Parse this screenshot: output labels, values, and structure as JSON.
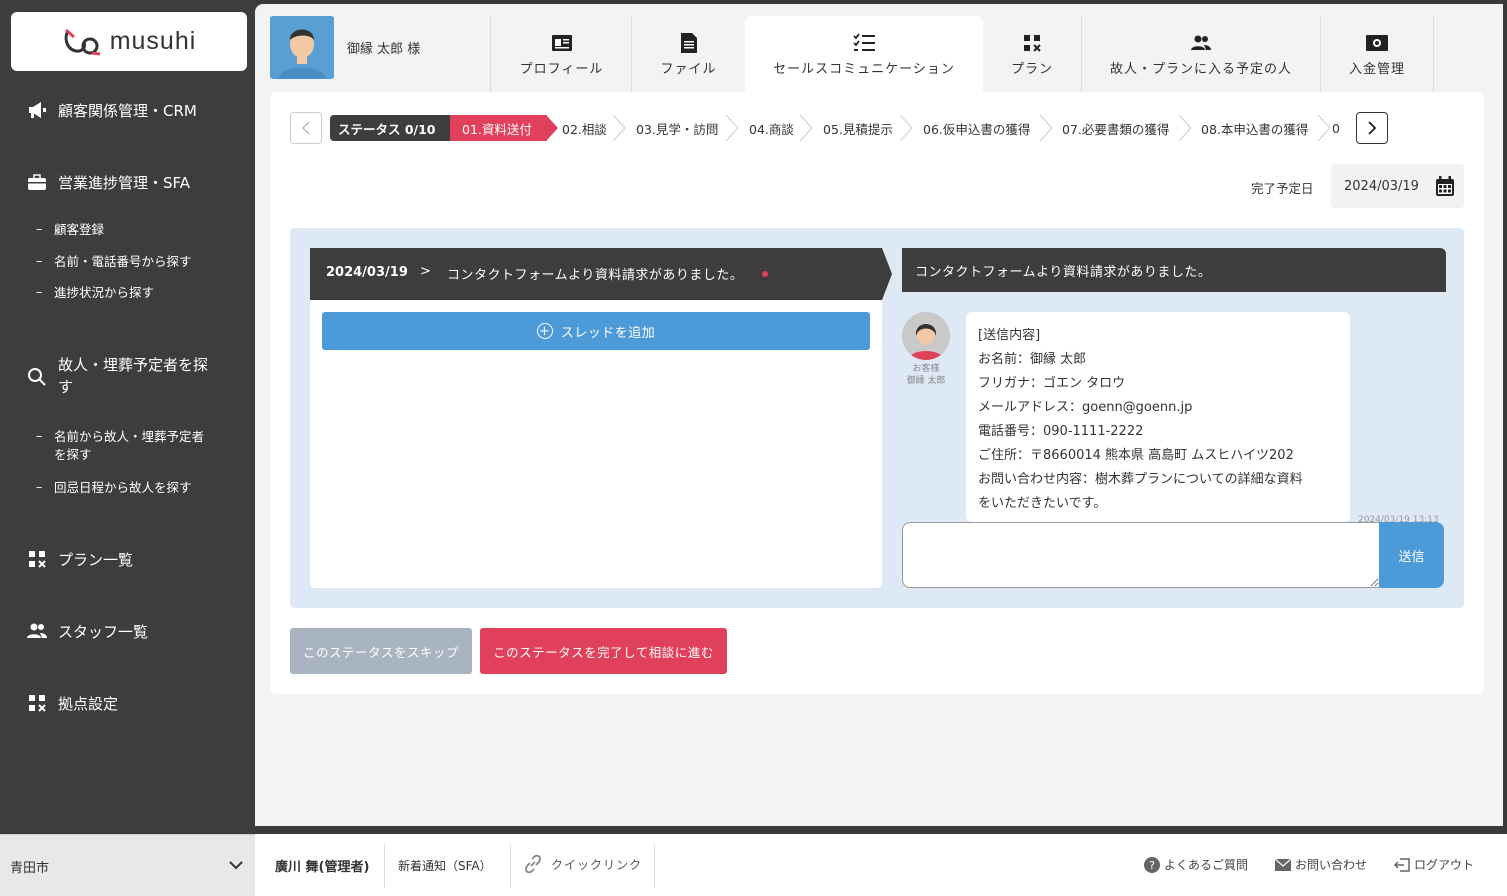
{
  "brand": {
    "name": "musuhi"
  },
  "sidebar": {
    "sections": [
      {
        "label": "顧客関係管理・CRM",
        "icon": "megaphone-icon"
      },
      {
        "label": "営業進捗管理・SFA",
        "icon": "briefcase-icon"
      }
    ],
    "sfa_items": [
      "顧客登録",
      "名前・電話番号から探す",
      "進捗状況から探す"
    ],
    "search_section": {
      "label_line1": "故人・埋葬予定者を探",
      "label_line2": "す",
      "icon": "search-icon"
    },
    "search_items": [
      {
        "line1": "名前から故人・埋葬予定者",
        "line2": "を探す"
      },
      {
        "line1": "回忌日程から故人を探す",
        "line2": ""
      }
    ],
    "bottom_sections": [
      {
        "label": "プラン一覧",
        "icon": "plan-icon"
      },
      {
        "label": "スタッフ一覧",
        "icon": "people-icon"
      },
      {
        "label": "拠点設定",
        "icon": "plan-icon"
      }
    ]
  },
  "customer": {
    "name": "御縁 太郎 様"
  },
  "tabs": [
    {
      "label": "プロフィール",
      "icon": "profile-card-icon"
    },
    {
      "label": "ファイル",
      "icon": "file-icon"
    },
    {
      "label": "セールスコミュニケーション",
      "icon": "checklist-icon"
    },
    {
      "label": "プラン",
      "icon": "plan-icon"
    },
    {
      "label": "故人・プランに入る予定の人",
      "icon": "people-icon"
    },
    {
      "label": "入金管理",
      "icon": "money-icon"
    }
  ],
  "status": {
    "label": "ステータス 0/10",
    "steps": [
      "01.資料送付",
      "02.相談",
      "03.見学・訪問",
      "04.商談",
      "05.見積提示",
      "06.仮申込書の獲得",
      "07.必要書類の獲得",
      "08.本申込書の獲得",
      "0"
    ],
    "active_index": 0
  },
  "due": {
    "label": "完了予定日",
    "value": "2024/03/19"
  },
  "thread": {
    "date": "2024/03/19",
    "separator": ">",
    "title": "コンタクトフォームより資料請求がありました。",
    "add_button": "スレッドを追加"
  },
  "conversation": {
    "title": "コンタクトフォームより資料請求がありました。",
    "sender_role": "お客様",
    "sender_name": "御縁 太郎",
    "message_lines": [
      "[送信内容]",
      "お名前：御縁 太郎",
      "フリガナ：ゴエン タロウ",
      "メールアドレス：goenn@goenn.jp",
      "電話番号：090-1111-2222",
      "ご住所：〒8660014 熊本県 高島町 ムスヒハイツ202",
      "お問い合わせ内容：樹木葬プランについての詳細な資料",
      "をいただきたいです。"
    ],
    "timestamp": "2024/03/19 13:13",
    "input_value": "",
    "send_label": "送信"
  },
  "actions": {
    "skip": "このステータスをスキップ",
    "complete": "このステータスを完了して相談に進む"
  },
  "footer": {
    "city": "青田市",
    "user": "廣川 舞(管理者)",
    "notice": "新着通知（SFA）",
    "quicklink": "クイックリンク",
    "faq": "よくあるご質問",
    "contact": "お問い合わせ",
    "logout": "ログアウト"
  },
  "colors": {
    "accent": "#4d9ad8",
    "danger": "#e0405a",
    "dark": "#3d3d3d"
  }
}
